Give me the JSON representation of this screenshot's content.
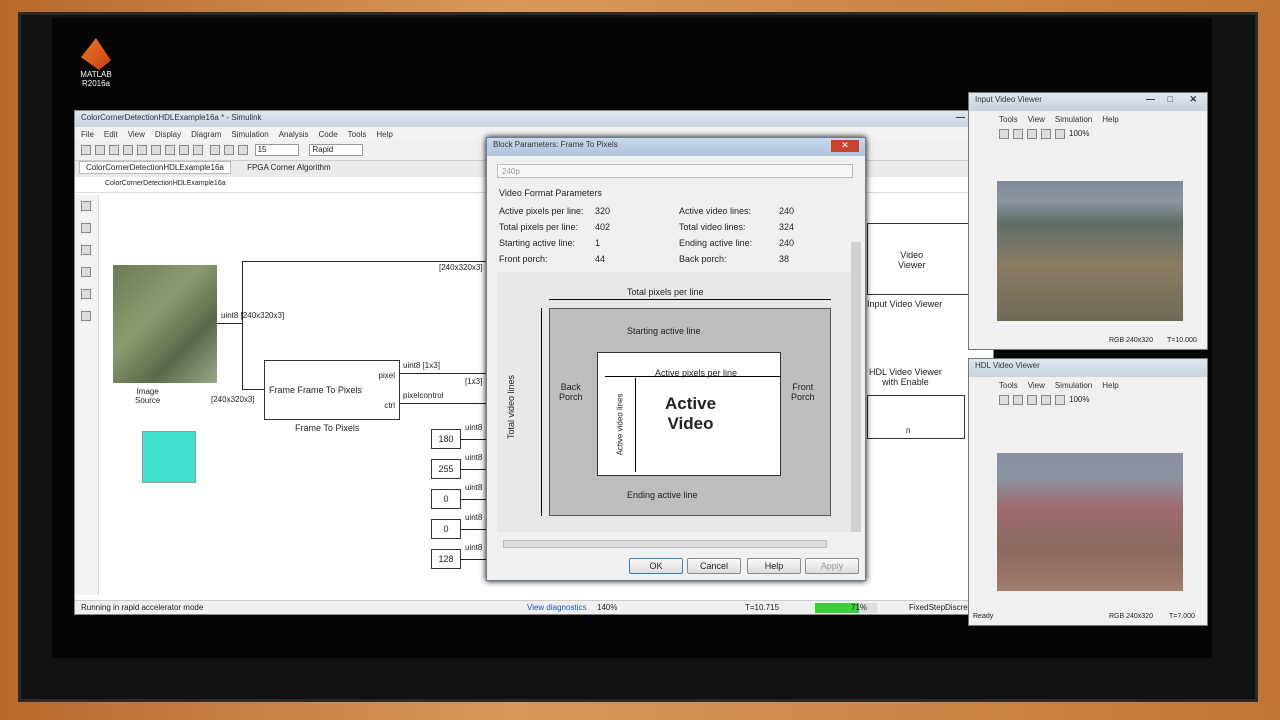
{
  "desktop": {
    "matlab_label": "MATLAB",
    "matlab_version": "R2016a"
  },
  "simulink": {
    "title": "ColorCornerDetectionHDLExample16a * - Simulink",
    "menu": [
      "File",
      "Edit",
      "View",
      "Display",
      "Diagram",
      "Simulation",
      "Analysis",
      "Code",
      "Tools",
      "Help"
    ],
    "stop_time": "15",
    "mode": "Rapid",
    "tabs": [
      "ColorCornerDetectionHDLExample16a",
      "FPGA Corner Algorithm"
    ],
    "breadcrumb": "ColorCornerDetectionHDLExample16a",
    "status_left": "Running in rapid accelerator mode",
    "status_diag": "View diagnostics",
    "status_zoom": "140%",
    "status_time": "T=10.715",
    "progress_text": "71%",
    "progress": 0.71,
    "status_solver": "FixedStepDiscrete"
  },
  "diagram": {
    "image_source": "Image\nSource",
    "sig_top": "[240x320x3]",
    "sig_uint8": "uint8 [240x320x3]",
    "sig_in": "[240x320x3]",
    "frame_block": "Frame  Frame To Pixels",
    "frame_label": "Frame To Pixels",
    "port_pixel": "pixel",
    "port_ctrl": "ctrl",
    "sig_pixel": "uint8 [1x3]",
    "sig_ctrl": "pixelcontrol",
    "sig_1x3": "[1x3]",
    "constants": [
      "180",
      "255",
      "0",
      "0",
      "128"
    ],
    "const_type": "uint8",
    "video_viewer": "Video\nViewer",
    "input_viewer_label": "Input Video Viewer",
    "hdl_viewer_label": "HDL Video Viewer\nwith Enable",
    "hdl_port": "n"
  },
  "dialog": {
    "title": "Block Parameters: Frame To Pixels",
    "format": "240p",
    "section": "Video Format Parameters",
    "left": [
      [
        "Active pixels per line:",
        "320"
      ],
      [
        "Total pixels per line:",
        "402"
      ],
      [
        "Starting active line:",
        "1"
      ],
      [
        "Front porch:",
        "44"
      ]
    ],
    "right": [
      [
        "Active video lines:",
        "240"
      ],
      [
        "Total video lines:",
        "324"
      ],
      [
        "Ending active line:",
        "240"
      ],
      [
        "Back porch:",
        "38"
      ]
    ],
    "fig": {
      "total_ppl": "Total pixels per line",
      "start_line": "Starting active line",
      "active_ppl": "Active pixels per line",
      "back": "Back\nPorch",
      "front": "Front\nPorch",
      "active": "Active\nVideo",
      "tvl": "Total video lines",
      "avl": "Active video lines",
      "end_line": "Ending active line"
    },
    "buttons": [
      "OK",
      "Cancel",
      "Help",
      "Apply"
    ]
  },
  "input_viewer": {
    "title": "Input Video Viewer",
    "menu": [
      "Tools",
      "View",
      "Simulation",
      "Help"
    ],
    "zoom": "100%",
    "status_fmt": "RGB 240x320",
    "status_t": "T=10.000"
  },
  "hdl_viewer": {
    "title": "HDL Video Viewer",
    "menu": [
      "Tools",
      "View",
      "Simulation",
      "Help"
    ],
    "zoom": "100%",
    "status_left": "Ready",
    "status_fmt": "RGB 240x320",
    "status_t": "T=7.000"
  }
}
